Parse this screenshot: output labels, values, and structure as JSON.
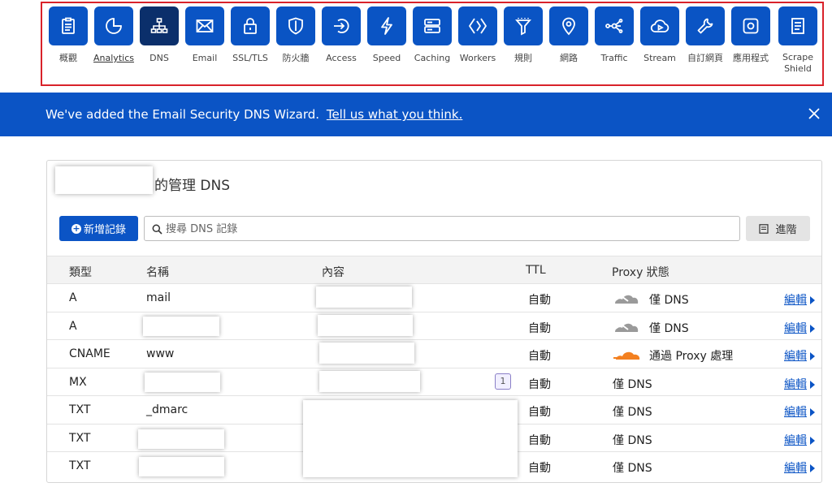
{
  "nav": {
    "items": [
      {
        "label": "概觀",
        "icon": "clipboard-icon"
      },
      {
        "label": "Analytics",
        "icon": "pie-chart-icon"
      },
      {
        "label": "DNS",
        "icon": "network-icon"
      },
      {
        "label": "Email",
        "icon": "envelope-icon"
      },
      {
        "label": "SSL/TLS",
        "icon": "lock-icon"
      },
      {
        "label": "防火牆",
        "icon": "shield-icon"
      },
      {
        "label": "Access",
        "icon": "access-arrow-icon"
      },
      {
        "label": "Speed",
        "icon": "lightning-icon"
      },
      {
        "label": "Caching",
        "icon": "server-icon"
      },
      {
        "label": "Workers",
        "icon": "code-brackets-icon"
      },
      {
        "label": "規則",
        "icon": "funnel-icon"
      },
      {
        "label": "網路",
        "icon": "location-pin-icon"
      },
      {
        "label": "Traffic",
        "icon": "traffic-split-icon"
      },
      {
        "label": "Stream",
        "icon": "cloud-play-icon"
      },
      {
        "label": "自訂網頁",
        "icon": "wrench-icon"
      },
      {
        "label": "應用程式",
        "icon": "app-icon"
      },
      {
        "label": "Scrape Shield",
        "icon": "document-icon"
      }
    ],
    "active": "DNS"
  },
  "banner": {
    "text": "We've added the Email Security DNS Wizard.",
    "link": "Tell us what you think."
  },
  "panel": {
    "title": "的管理 DNS",
    "add_label": "新增記錄",
    "search_placeholder": "搜尋 DNS 記錄",
    "advanced_label": "進階"
  },
  "table": {
    "headers": {
      "type": "類型",
      "name": "名稱",
      "content": "內容",
      "ttl": "TTL",
      "proxy": "Proxy 狀態"
    },
    "edit_label": "編輯",
    "rows": [
      {
        "type": "A",
        "name": "mail",
        "ttl": "自動",
        "proxy": "僅 DNS",
        "cloud": "grey"
      },
      {
        "type": "A",
        "name": "",
        "ttl": "自動",
        "proxy": "僅 DNS",
        "cloud": "grey"
      },
      {
        "type": "CNAME",
        "name": "www",
        "ttl": "自動",
        "proxy": "通過 Proxy 處理",
        "cloud": "orange"
      },
      {
        "type": "MX",
        "name": "",
        "ttl": "自動",
        "proxy": "僅 DNS",
        "cloud": "none",
        "priority": "1"
      },
      {
        "type": "TXT",
        "name": "_dmarc",
        "ttl": "自動",
        "proxy": "僅 DNS",
        "cloud": "none"
      },
      {
        "type": "TXT",
        "name": "",
        "ttl": "自動",
        "proxy": "僅 DNS",
        "cloud": "none"
      },
      {
        "type": "TXT",
        "name": "",
        "ttl": "自動",
        "proxy": "僅 DNS",
        "cloud": "none"
      }
    ]
  },
  "colors": {
    "accent": "#0b54c5",
    "active_nav": "#0b2f6b",
    "highlight_border": "#d9222a",
    "proxy_orange": "#f38020"
  }
}
